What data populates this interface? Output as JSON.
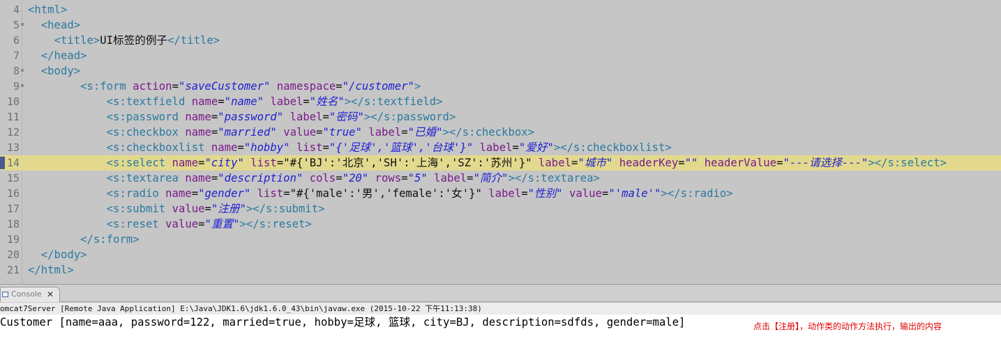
{
  "editor": {
    "lines": [
      {
        "num": "4",
        "segments": [
          [
            "tg",
            "<html>"
          ]
        ]
      },
      {
        "num": "5",
        "segments": [
          [
            "tx",
            "  "
          ],
          [
            "tg",
            "<head>"
          ]
        ]
      },
      {
        "num": "6",
        "segments": [
          [
            "tx",
            "    "
          ],
          [
            "tg",
            "<title>"
          ],
          [
            "tx",
            "UI标签的例子"
          ],
          [
            "tg",
            "</title>"
          ]
        ]
      },
      {
        "num": "7",
        "segments": [
          [
            "tx",
            "  "
          ],
          [
            "tg",
            "</head>"
          ]
        ]
      },
      {
        "num": "8",
        "segments": [
          [
            "tx",
            "  "
          ],
          [
            "tg",
            "<body>"
          ]
        ]
      },
      {
        "num": "9",
        "segments": [
          [
            "tx",
            "        "
          ],
          [
            "tg",
            "<s:form "
          ],
          [
            "at",
            "action"
          ],
          [
            "tx",
            "="
          ],
          [
            "vl",
            "\"saveCustomer\""
          ],
          [
            "tx",
            " "
          ],
          [
            "at",
            "namespace"
          ],
          [
            "tx",
            "="
          ],
          [
            "vl",
            "\"/customer\""
          ],
          [
            "tg",
            ">"
          ]
        ]
      },
      {
        "num": "10",
        "segments": [
          [
            "tx",
            "            "
          ],
          [
            "tg",
            "<s:textfield "
          ],
          [
            "at",
            "name"
          ],
          [
            "tx",
            "="
          ],
          [
            "vl",
            "\"name\""
          ],
          [
            "tx",
            " "
          ],
          [
            "at",
            "label"
          ],
          [
            "tx",
            "="
          ],
          [
            "vl",
            "\"姓名\""
          ],
          [
            "tg",
            "></s:textfield>"
          ]
        ]
      },
      {
        "num": "11",
        "segments": [
          [
            "tx",
            "            "
          ],
          [
            "tg",
            "<s:password "
          ],
          [
            "at",
            "name"
          ],
          [
            "tx",
            "="
          ],
          [
            "vl",
            "\"password\""
          ],
          [
            "tx",
            " "
          ],
          [
            "at",
            "label"
          ],
          [
            "tx",
            "="
          ],
          [
            "vl",
            "\"密码\""
          ],
          [
            "tg",
            "></s:password>"
          ]
        ]
      },
      {
        "num": "12",
        "segments": [
          [
            "tx",
            "            "
          ],
          [
            "tg",
            "<s:checkbox "
          ],
          [
            "at",
            "name"
          ],
          [
            "tx",
            "="
          ],
          [
            "vl",
            "\"married\""
          ],
          [
            "tx",
            " "
          ],
          [
            "at",
            "value"
          ],
          [
            "tx",
            "="
          ],
          [
            "vl",
            "\"true\""
          ],
          [
            "tx",
            " "
          ],
          [
            "at",
            "label"
          ],
          [
            "tx",
            "="
          ],
          [
            "vl",
            "\"已婚\""
          ],
          [
            "tg",
            "></s:checkbox>"
          ]
        ]
      },
      {
        "num": "13",
        "segments": [
          [
            "tx",
            "            "
          ],
          [
            "tg",
            "<s:checkboxlist "
          ],
          [
            "at",
            "name"
          ],
          [
            "tx",
            "="
          ],
          [
            "vl",
            "\"hobby\""
          ],
          [
            "tx",
            " "
          ],
          [
            "at",
            "list"
          ],
          [
            "tx",
            "="
          ],
          [
            "vl",
            "\"{'足球','篮球','台球'}\""
          ],
          [
            "tx",
            " "
          ],
          [
            "at",
            "label"
          ],
          [
            "tx",
            "="
          ],
          [
            "vl",
            "\"爱好\""
          ],
          [
            "tg",
            "></s:checkboxlist>"
          ]
        ]
      },
      {
        "num": "14",
        "current": true,
        "segments": [
          [
            "tx",
            "            "
          ],
          [
            "tg",
            "<s:select "
          ],
          [
            "at",
            "name"
          ],
          [
            "tx",
            "="
          ],
          [
            "vl",
            "\"city\""
          ],
          [
            "tx",
            " "
          ],
          [
            "at",
            "list"
          ],
          [
            "tx",
            "="
          ],
          [
            "tx",
            "\"#{'BJ':'北京','SH':'上海','SZ':'苏州'}\""
          ],
          [
            "tx",
            " "
          ],
          [
            "at",
            "label"
          ],
          [
            "tx",
            "="
          ],
          [
            "vl",
            "\"城市\""
          ],
          [
            "tx",
            " "
          ],
          [
            "at",
            "headerKey"
          ],
          [
            "tx",
            "="
          ],
          [
            "vl",
            "\"\""
          ],
          [
            "tx",
            " "
          ],
          [
            "at",
            "headerValue"
          ],
          [
            "tx",
            "="
          ],
          [
            "vl",
            "\"---请选择---\""
          ],
          [
            "tg",
            "></s:select>"
          ]
        ]
      },
      {
        "num": "15",
        "segments": [
          [
            "tx",
            "            "
          ],
          [
            "tg",
            "<s:textarea "
          ],
          [
            "at",
            "name"
          ],
          [
            "tx",
            "="
          ],
          [
            "vl",
            "\"description\""
          ],
          [
            "tx",
            " "
          ],
          [
            "at",
            "cols"
          ],
          [
            "tx",
            "="
          ],
          [
            "vl",
            "\"20\""
          ],
          [
            "tx",
            " "
          ],
          [
            "at",
            "rows"
          ],
          [
            "tx",
            "="
          ],
          [
            "vl",
            "\"5\""
          ],
          [
            "tx",
            " "
          ],
          [
            "at",
            "label"
          ],
          [
            "tx",
            "="
          ],
          [
            "vl",
            "\"简介\""
          ],
          [
            "tg",
            "></s:textarea>"
          ]
        ]
      },
      {
        "num": "16",
        "segments": [
          [
            "tx",
            "            "
          ],
          [
            "tg",
            "<s:radio "
          ],
          [
            "at",
            "name"
          ],
          [
            "tx",
            "="
          ],
          [
            "vl",
            "\"gender\""
          ],
          [
            "tx",
            " "
          ],
          [
            "at",
            "list"
          ],
          [
            "tx",
            "="
          ],
          [
            "tx",
            "\"#{'male':'男','female':'女'}\""
          ],
          [
            "tx",
            " "
          ],
          [
            "at",
            "label"
          ],
          [
            "tx",
            "="
          ],
          [
            "vl",
            "\"性别\""
          ],
          [
            "tx",
            " "
          ],
          [
            "at",
            "value"
          ],
          [
            "tx",
            "="
          ],
          [
            "vl",
            "\"'male'\""
          ],
          [
            "tg",
            "></s:radio>"
          ]
        ]
      },
      {
        "num": "17",
        "segments": [
          [
            "tx",
            "            "
          ],
          [
            "tg",
            "<s:submit "
          ],
          [
            "at",
            "value"
          ],
          [
            "tx",
            "="
          ],
          [
            "vl",
            "\"注册\""
          ],
          [
            "tg",
            "></s:submit>"
          ]
        ]
      },
      {
        "num": "18",
        "segments": [
          [
            "tx",
            "            "
          ],
          [
            "tg",
            "<s:reset "
          ],
          [
            "at",
            "value"
          ],
          [
            "tx",
            "="
          ],
          [
            "vl",
            "\"重置\""
          ],
          [
            "tg",
            "></s:reset>"
          ]
        ]
      },
      {
        "num": "19",
        "segments": [
          [
            "tx",
            "        "
          ],
          [
            "tg",
            "</s:form>"
          ]
        ]
      },
      {
        "num": "20",
        "segments": [
          [
            "tx",
            "  "
          ],
          [
            "tg",
            "</body>"
          ]
        ]
      },
      {
        "num": "21",
        "segments": [
          [
            "tg",
            "</html>"
          ]
        ]
      }
    ],
    "colors": {
      "background": "#c6c6c6",
      "tag": "#2b7a9f",
      "attribute": "#7a1a8a",
      "value": "#1f1fd0",
      "current_line": "#e2d98e"
    }
  },
  "console": {
    "tab_label": "Console",
    "close_glyph": "✕",
    "header": "omcat7Server [Remote Java Application] E:\\Java\\JDK1.6\\jdk1.6.0_43\\bin\\javaw.exe (2015-10-22 下午11:13:38)",
    "output": "Customer [name=aaa, password=122, married=true, hobby=足球, 篮球, city=BJ, description=sdfds, gender=male]",
    "annotation": "点击【注册】，动作类的动作方法执行，输出的内容",
    "annotation_color": "#e00000"
  }
}
